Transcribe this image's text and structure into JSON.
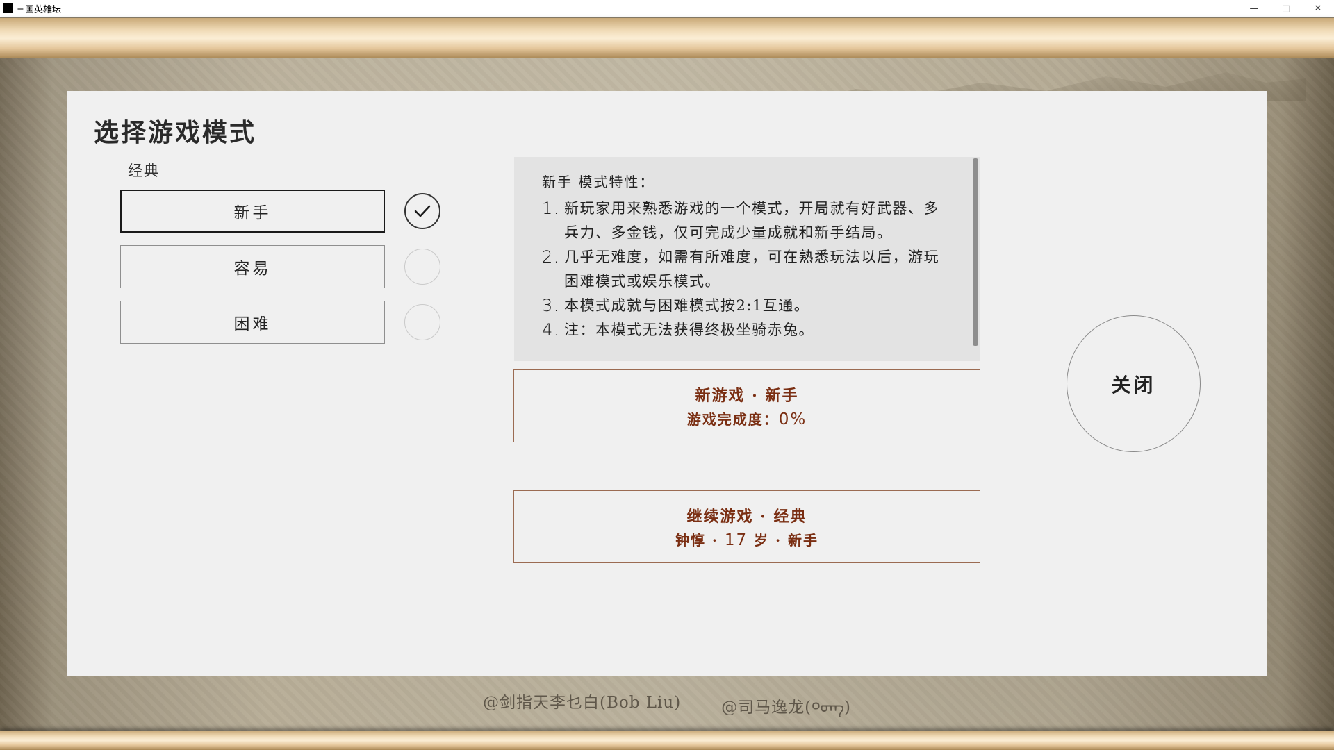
{
  "window": {
    "title": "三国英雄坛",
    "minimize_icon": "minimize-icon",
    "maximize_icon": "maximize-icon",
    "close_icon": "close-icon"
  },
  "panel": {
    "title": "选择游戏模式",
    "section_label": "经典",
    "modes": [
      {
        "label": "新手",
        "selected": true
      },
      {
        "label": "容易",
        "selected": false
      },
      {
        "label": "困难",
        "selected": false
      }
    ]
  },
  "description": {
    "heading": "新手 模式特性：",
    "items": [
      {
        "num": "1.",
        "text": "新玩家用来熟悉游戏的一个模式，开局就有好武器、多兵力、多金钱，仅可完成少量成就和新手结局。"
      },
      {
        "num": "2.",
        "text": "几乎无难度，如需有所难度，可在熟悉玩法以后，游玩困难模式或娱乐模式。"
      },
      {
        "num": "3.",
        "text": "本模式成就与困难模式按2:1互通。"
      },
      {
        "num": "4.",
        "text": "注：本模式无法获得终极坐骑赤兔。"
      }
    ]
  },
  "actions": {
    "new_game": {
      "line1": "新游戏 · 新手",
      "progress_label": "游戏完成度：",
      "progress_value": "0%"
    },
    "continue_game": {
      "line1": "继续游戏 · 经典",
      "char_name": "钟惇 · ",
      "char_age": "17",
      "char_suffix": " 岁 · 新手"
    }
  },
  "close_label": "关闭",
  "credits": [
    "@剑指天李乜白(Bob Liu)",
    "@司马逸龙(ᢀ᠋ᠦ᠋ᡢ)"
  ],
  "colors": {
    "accent_text": "#7a2e12",
    "panel_bg": "#f0f0f0",
    "desc_bg": "#e3e3e3"
  }
}
